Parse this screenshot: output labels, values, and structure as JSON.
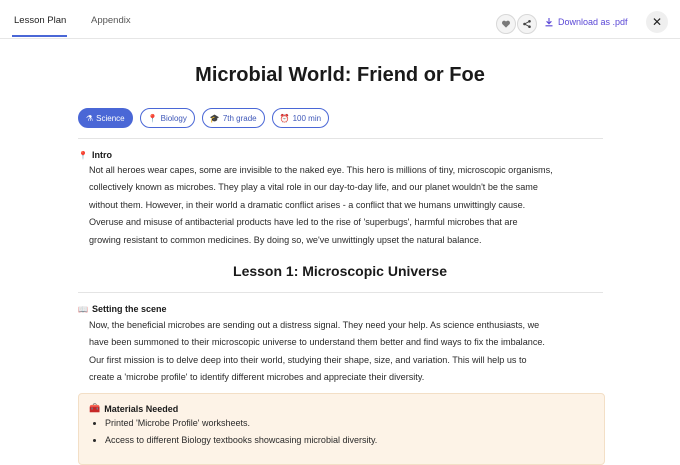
{
  "tabs": [
    {
      "label": "Lesson Plan",
      "active": true
    },
    {
      "label": "Appendix",
      "active": false
    }
  ],
  "actions": {
    "favorite_icon": "heart-icon",
    "share_icon": "share-icon",
    "download_label": "Download as .pdf",
    "close_label": "✕"
  },
  "page": {
    "title": "Microbial World: Friend or Foe",
    "tags": [
      {
        "icon": "flask-icon",
        "label": "Science"
      },
      {
        "icon": "pin-icon",
        "label": "Biology"
      },
      {
        "icon": "graduation-cap-icon",
        "label": "7th grade"
      },
      {
        "icon": "alarm-clock-icon",
        "label": "100 min"
      }
    ]
  },
  "intro": {
    "heading": "Intro",
    "lines": [
      "Not all heroes wear capes, some are invisible to the naked eye. This hero is millions of tiny, microscopic organisms,",
      "collectively known as microbes. They play a vital role in our day-to-day life, and our planet wouldn't be the same",
      "without them. However, in their world a dramatic conflict arises - a conflict that we humans unwittingly cause.",
      "Overuse and misuse of antibacterial products have led to the rise of 'superbugs', harmful microbes that are",
      "growing resistant to common medicines. By doing so, we've unwittingly upset the natural balance."
    ]
  },
  "lesson1": {
    "title": "Lesson 1: Microscopic Universe",
    "scene_heading": "Setting the scene",
    "scene_lines": [
      "Now, the beneficial microbes are sending out a distress signal. They need your help. As science enthusiasts, we",
      "have been summoned to their microscopic universe to understand them better and find ways to fix the imbalance.",
      "Our first mission is to delve deep into their world, studying their shape, size, and variation. This will help us to",
      "create a 'microbe profile' to identify different microbes and appreciate their diversity."
    ],
    "materials_heading": "Materials Needed",
    "materials": [
      "Printed 'Microbe Profile' worksheets.",
      "Access to different Biology textbooks showcasing microbial diversity."
    ]
  },
  "colors": {
    "accent": "#4a67d6",
    "download": "#5a47d6",
    "materials_bg": "#fdf3e7"
  }
}
